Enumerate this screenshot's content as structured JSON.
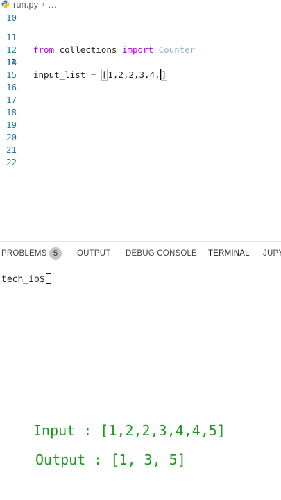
{
  "breadcrumb": {
    "file": "run.py",
    "separator": "›",
    "more": "…"
  },
  "editor": {
    "lines": [
      {
        "num": "10",
        "code": ""
      },
      {
        "num": "11",
        "code": "from collections import Counter"
      },
      {
        "num": "12",
        "code": ""
      },
      {
        "num": "13",
        "code": "input_list = [1,2,2,3,4,]"
      },
      {
        "num": "14",
        "code": ""
      },
      {
        "num": "15",
        "code": ""
      },
      {
        "num": "16",
        "code": ""
      },
      {
        "num": "17",
        "code": ""
      },
      {
        "num": "18",
        "code": ""
      },
      {
        "num": "19",
        "code": ""
      },
      {
        "num": "20",
        "code": ""
      },
      {
        "num": "21",
        "code": ""
      },
      {
        "num": "22",
        "code": ""
      }
    ],
    "tokens": {
      "from": "from",
      "module": " collections ",
      "import": "import",
      "counter": " Counter",
      "list_prefix": "input_list = ",
      "open_bracket": "[",
      "list_values": "1,2,2,3,4,",
      "close_bracket": "]"
    }
  },
  "panel": {
    "tabs": {
      "problems": "PROBLEMS",
      "problems_count": "5",
      "output": "OUTPUT",
      "debug_console": "DEBUG CONSOLE",
      "terminal": "TERMINAL",
      "jupyter": "JUPY"
    },
    "active_tab": "TERMINAL",
    "terminal_prompt": "tech_io$"
  },
  "annotation": {
    "input": "Input : [1,2,2,3,4,4,5]",
    "output": "Output : [1, 3, 5]"
  },
  "colors": {
    "keyword": "#af00db",
    "class_name": "#8fb7c2",
    "line_number": "#237893",
    "annotation_green": "#1a9b1a"
  }
}
